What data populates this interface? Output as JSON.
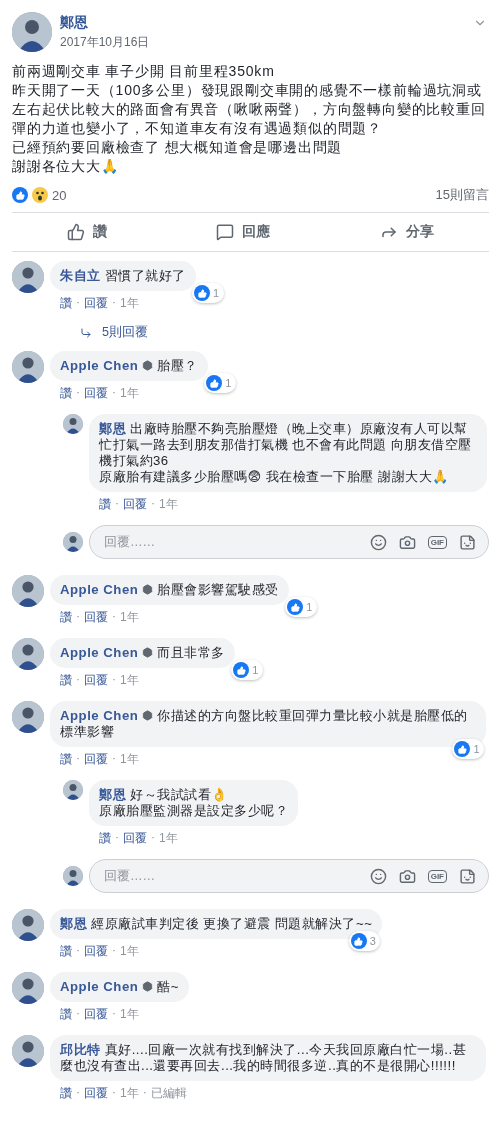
{
  "post": {
    "author": "鄭恩",
    "date": "2017年10月16日",
    "body": [
      "前兩週剛交車 車子少開 目前里程350km",
      "昨天開了一天（100多公里）發現跟剛交車開的感覺不一樣前輪過坑洞或左右起伏比較大的路面會有異音（啾啾兩聲），方向盤轉向變的比較重回彈的力道也變小了，不知道車友有沒有遇過類似的問題？",
      "已經預約要回廠檢查了 想大概知道會是哪邊出問題",
      "謝謝各位大大🙏"
    ],
    "reaction_count": "20",
    "comment_count": "15則留言",
    "actions": [
      "讚",
      "回應",
      "分享"
    ]
  },
  "comments": [
    {
      "kind": "comment",
      "author": "朱自立",
      "text": "習慣了就好了",
      "likes": "1",
      "meta": [
        "讚",
        "·",
        "回覆",
        "·",
        "1年"
      ]
    },
    {
      "kind": "replies_link",
      "text": "5則回覆"
    },
    {
      "kind": "comment",
      "author": "Apple Chen",
      "badge": true,
      "text": "胎壓？",
      "likes": "1",
      "meta": [
        "讚",
        "·",
        "回覆",
        "·",
        "1年"
      ]
    },
    {
      "kind": "reply",
      "author": "鄭恩",
      "text": "出廠時胎壓不夠亮胎壓燈（晚上交車）原廠沒有人可以幫忙打氣一路去到朋友那借打氣機 也不會有此問題 向朋友借空壓機打氣約36\n原廠胎有建議多少胎壓嗎😨 我在檢查一下胎壓 謝謝大大🙏",
      "meta": [
        "讚",
        "·",
        "回覆",
        "·",
        "1年"
      ]
    },
    {
      "kind": "reply_box",
      "placeholder": "回覆……",
      "gif": "GIF"
    },
    {
      "kind": "comment",
      "author": "Apple Chen",
      "badge": true,
      "text": "胎壓會影響駕駛感受",
      "likes": "1",
      "meta": [
        "讚",
        "·",
        "回覆",
        "·",
        "1年"
      ]
    },
    {
      "kind": "comment",
      "author": "Apple Chen",
      "badge": true,
      "text": "而且非常多",
      "likes": "1",
      "meta": [
        "讚",
        "·",
        "回覆",
        "·",
        "1年"
      ]
    },
    {
      "kind": "comment",
      "author": "Apple Chen",
      "badge": true,
      "text": "你描述的方向盤比較重回彈力量比較小就是胎壓低的標準影響",
      "likes": "1",
      "meta": [
        "讚",
        "·",
        "回覆",
        "·",
        "1年"
      ]
    },
    {
      "kind": "reply",
      "author": "鄭恩",
      "text": "好～我試試看👌\n原廠胎壓監測器是設定多少呢？",
      "meta": [
        "讚",
        "·",
        "回覆",
        "·",
        "1年"
      ]
    },
    {
      "kind": "reply_box",
      "placeholder": "回覆……",
      "gif": "GIF"
    },
    {
      "kind": "comment",
      "author": "鄭恩",
      "text": "經原廠試車判定後 更換了避震 問題就解決了~~",
      "likes": "3",
      "meta": [
        "讚",
        "·",
        "回覆",
        "·",
        "1年"
      ]
    },
    {
      "kind": "comment",
      "author": "Apple Chen",
      "badge": true,
      "text": "酷~",
      "meta": [
        "讚",
        "·",
        "回覆",
        "·",
        "1年"
      ]
    },
    {
      "kind": "comment",
      "author": "邱比特",
      "text": "真好....回廠一次就有找到解決了...今天我回原廠白忙一場..甚麼也沒有查出...還要再回去...我的時間很多逆..真的不是很開心!!!!!!",
      "meta": [
        "讚",
        "·",
        "回覆",
        "·",
        "1年",
        "·",
        "已編輯"
      ]
    }
  ]
}
